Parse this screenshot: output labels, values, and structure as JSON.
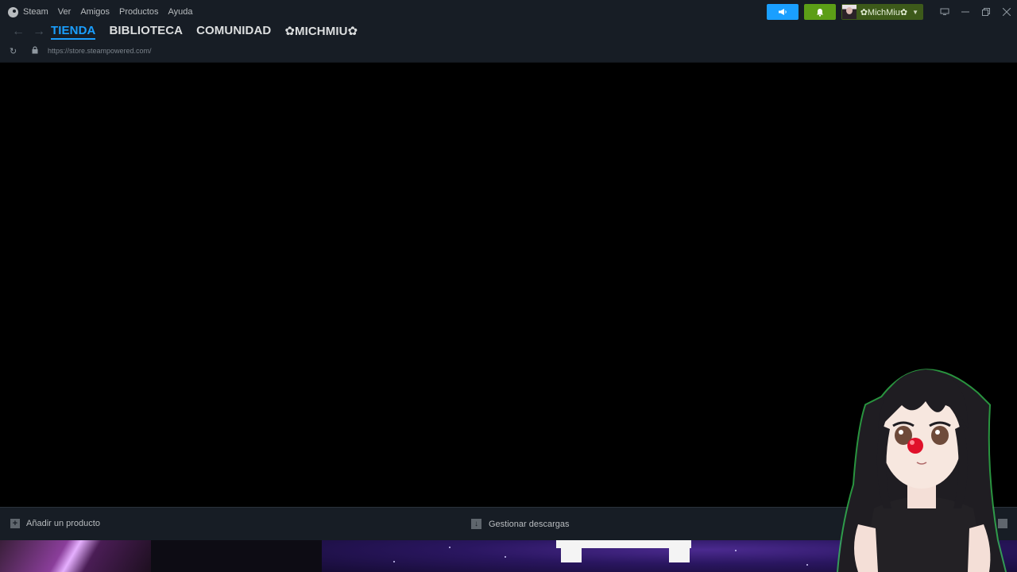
{
  "menu": {
    "app": "Steam",
    "items": [
      "Ver",
      "Amigos",
      "Productos",
      "Ayuda"
    ]
  },
  "account": {
    "name": "✿MichMiu✿"
  },
  "nav": {
    "tabs": [
      "TIENDA",
      "BIBLIOTECA",
      "COMUNIDAD",
      "✿MICHMIU✿"
    ],
    "active_tab": "TIENDA",
    "url": "https://store.steampowered.com/"
  },
  "footer": {
    "add_product": "Añadir un producto",
    "manage_downloads": "Gestionar descargas"
  },
  "colors": {
    "accent_blue": "#1a9fff",
    "accent_green": "#5c9e17",
    "bar_bg": "#171d25"
  },
  "icons": {
    "steam": "steam-logo-icon",
    "broadcast": "megaphone-icon",
    "notifications": "bell-icon",
    "big_picture": "monitor-icon",
    "back": "arrow-left-icon",
    "forward": "arrow-right-icon",
    "reload": "reload-icon",
    "lock": "lock-icon",
    "add": "plus-icon",
    "downloads": "download-icon"
  }
}
